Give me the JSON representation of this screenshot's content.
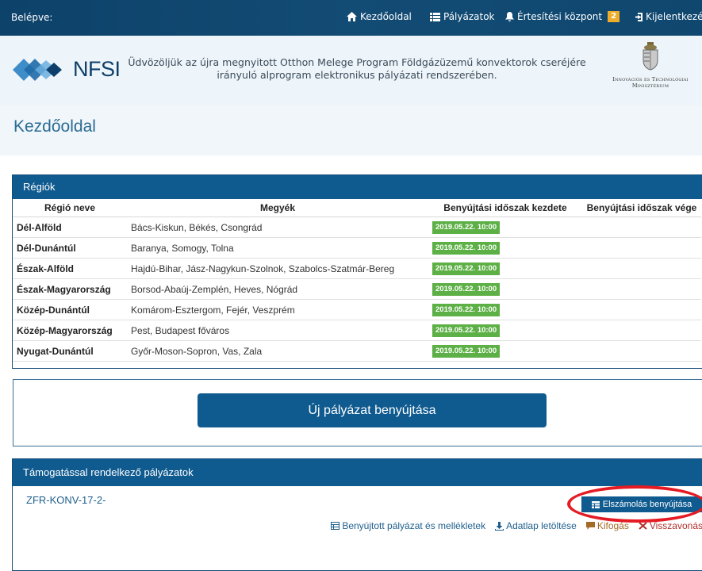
{
  "topbar": {
    "status": "Belépve:",
    "home": "Kezdőoldal",
    "applications": "Pályázatok",
    "notifications": "Értesítési központ",
    "notification_count": "2",
    "logout": "Kijelentkezé"
  },
  "header": {
    "logo_text": "NFSI",
    "welcome": "Üdvözöljük az újra megnyitott Otthon Melege Program Földgázüzemű konvektorok cseréjére irányuló alprogram elektronikus pályázati rendszerében.",
    "ministry_line1": "Innovációs és Technológiai",
    "ministry_line2": "Minisztérium"
  },
  "page": {
    "title": "Kezdőoldal"
  },
  "regions": {
    "panel_title": "Régiók",
    "columns": [
      "Régió neve",
      "Megyék",
      "Benyújtási időszak kezdete",
      "Benyújtási időszak vége"
    ],
    "rows": [
      {
        "name": "Dél-Alföld",
        "counties": "Bács-Kiskun, Békés, Csongrád",
        "start": "2019.05.22. 10:00"
      },
      {
        "name": "Dél-Dunántúl",
        "counties": "Baranya, Somogy, Tolna",
        "start": "2019.05.22. 10:00"
      },
      {
        "name": "Észak-Alföld",
        "counties": "Hajdú-Bihar, Jász-Nagykun-Szolnok, Szabolcs-Szatmár-Bereg",
        "start": "2019.05.22. 10:00"
      },
      {
        "name": "Észak-Magyarország",
        "counties": "Borsod-Abaúj-Zemplén, Heves, Nógrád",
        "start": "2019.05.22. 10:00"
      },
      {
        "name": "Közép-Dunántúl",
        "counties": "Komárom-Esztergom, Fejér, Veszprém",
        "start": "2019.05.22. 10:00"
      },
      {
        "name": "Közép-Magyarország",
        "counties": "Pest, Budapest főváros",
        "start": "2019.05.22. 10:00"
      },
      {
        "name": "Nyugat-Dunántúl",
        "counties": "Győr-Moson-Sopron, Vas, Zala",
        "start": "2019.05.22. 10:00"
      }
    ]
  },
  "new_application": {
    "button": "Új pályázat benyújtása"
  },
  "supported": {
    "panel_title": "Támogatással rendelkező pályázatok",
    "app_id": "ZFR-KONV-17-2-",
    "settle_button": "Elszámolás benyújtása",
    "actions": {
      "submitted": "Benyújtott pályázat és mellékletek",
      "download": "Adatlap letöltése",
      "objection": "Kifogás",
      "withdraw": "Visszavonás"
    }
  },
  "colors": {
    "nav_bg": "#0e4770",
    "panel_header": "#0f5a8f",
    "date_badge": "#5db046",
    "highlight_ring": "#e51b23",
    "notification_badge": "#f0ad2c"
  }
}
